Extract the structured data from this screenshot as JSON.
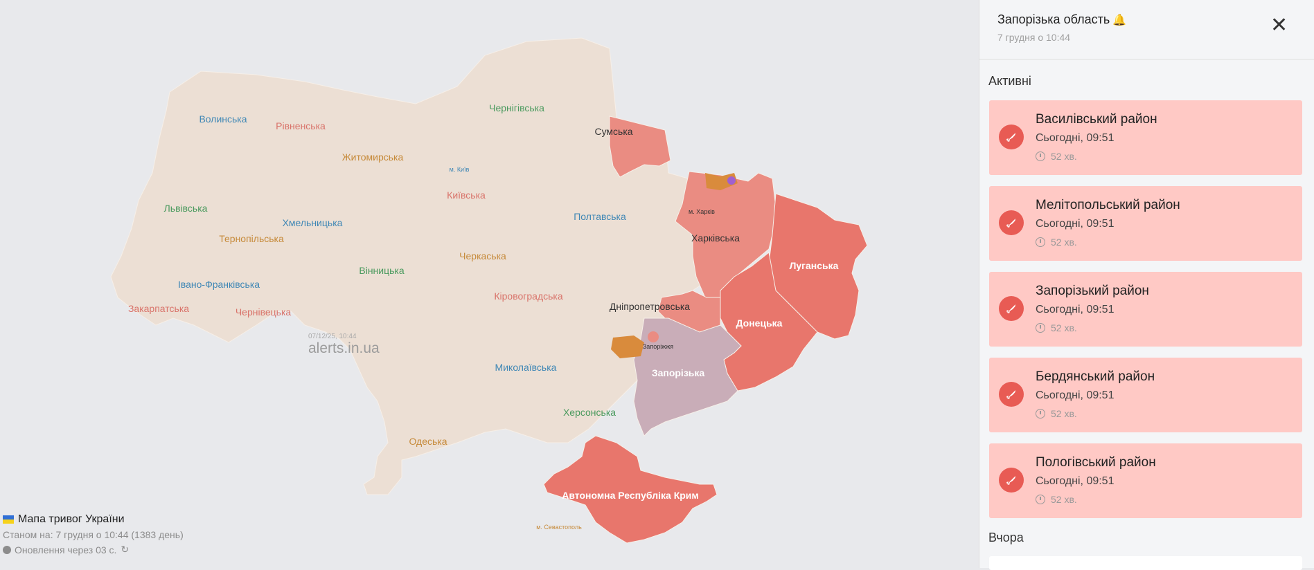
{
  "map": {
    "watermark": "alerts.in.ua",
    "watermark_date": "07/12/25, 10:44",
    "regions": [
      {
        "name": "Волинська",
        "color": "#3f87b5"
      },
      {
        "name": "Рівненська",
        "color": "#d9736a"
      },
      {
        "name": "Житомирська",
        "color": "#c68a3a"
      },
      {
        "name": "Чернігівська",
        "color": "#4a9a5e"
      },
      {
        "name": "Сумська",
        "color": "#333333"
      },
      {
        "name": "м. Київ",
        "color": "#3f87b5"
      },
      {
        "name": "Київська",
        "color": "#d9736a"
      },
      {
        "name": "Львівська",
        "color": "#4a9a5e"
      },
      {
        "name": "Хмельницька",
        "color": "#3f87b5"
      },
      {
        "name": "Тернопільська",
        "color": "#c68a3a"
      },
      {
        "name": "Полтавська",
        "color": "#3f87b5"
      },
      {
        "name": "м. Харків",
        "color": "#333333"
      },
      {
        "name": "Харківська",
        "color": "#333333"
      },
      {
        "name": "Луганська",
        "color": "#ffffff"
      },
      {
        "name": "Черкаська",
        "color": "#c68a3a"
      },
      {
        "name": "Вінницька",
        "color": "#4a9a5e"
      },
      {
        "name": "Івано-Франківська",
        "color": "#3f87b5"
      },
      {
        "name": "Закарпатська",
        "color": "#d9736a"
      },
      {
        "name": "Чернівецька",
        "color": "#d9736a"
      },
      {
        "name": "Кіровоградська",
        "color": "#d9736a"
      },
      {
        "name": "Дніпропетровська",
        "color": "#333333"
      },
      {
        "name": "Донецька",
        "color": "#ffffff"
      },
      {
        "name": "Запоріжжя",
        "color": "#333333"
      },
      {
        "name": "Запорізька",
        "color": "#ffffff"
      },
      {
        "name": "Миколаївська",
        "color": "#3f87b5"
      },
      {
        "name": "Херсонська",
        "color": "#4a9a5e"
      },
      {
        "name": "Одеська",
        "color": "#c68a3a"
      },
      {
        "name": "Автономна Республіка Крим",
        "color": "#ffffff"
      },
      {
        "name": "м. Севастополь",
        "color": "#c68a3a"
      }
    ],
    "colors": {
      "calm": "#ecdfd4",
      "alert": "#e8766c",
      "alert_light": "#ea8c82",
      "selected": "#c9adb8",
      "background": "#e8e9ec"
    }
  },
  "footer": {
    "title": "Мапа тривог України",
    "status": "Станом на: 7 грудня о 10:44 (1383 день)",
    "update": "Оновлення через 03 с."
  },
  "panel": {
    "title": "Запорізька область",
    "subtitle": "7 грудня о 10:44",
    "active_label": "Активні",
    "yesterday_label": "Вчора",
    "alerts": [
      {
        "name": "Василівський район",
        "time": "Сьогодні, 09:51",
        "duration": "52 хв."
      },
      {
        "name": "Мелітопольський район",
        "time": "Сьогодні, 09:51",
        "duration": "52 хв."
      },
      {
        "name": "Запорізький район",
        "time": "Сьогодні, 09:51",
        "duration": "52 хв."
      },
      {
        "name": "Бердянський район",
        "time": "Сьогодні, 09:51",
        "duration": "52 хв."
      },
      {
        "name": "Пологівський район",
        "time": "Сьогодні, 09:51",
        "duration": "52 хв."
      }
    ]
  }
}
